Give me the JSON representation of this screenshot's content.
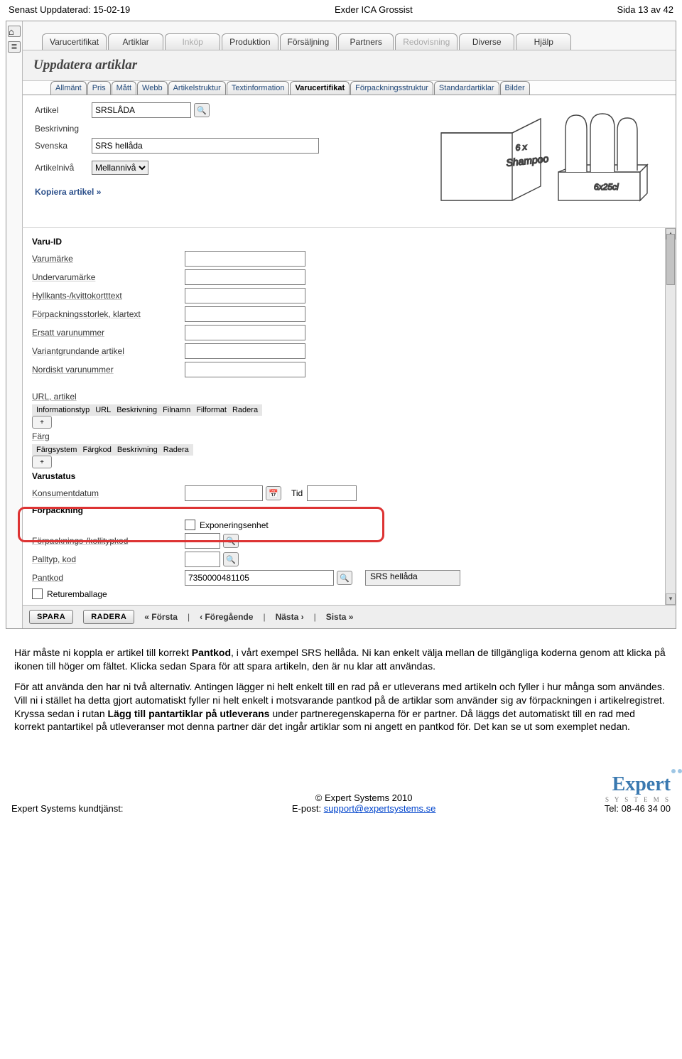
{
  "doc_header": {
    "left": "Senast Uppdaterad: 15-02-19",
    "center": "Exder ICA Grossist",
    "right": "Sida 13 av 42"
  },
  "toolbar_tabs": [
    "Varucertifikat",
    "Artiklar",
    "Inköp",
    "Produktion",
    "Försäljning",
    "Partners",
    "Redovisning",
    "Diverse",
    "Hjälp"
  ],
  "toolbar_disabled": [
    2,
    6
  ],
  "heading": "Uppdatera artiklar",
  "subtabs": [
    "Allmänt",
    "Pris",
    "Mått",
    "Webb",
    "Artikelstruktur",
    "Textinformation",
    "Varucertifikat",
    "Förpackningsstruktur",
    "Standardartiklar",
    "Bilder"
  ],
  "subtab_active": 6,
  "form": {
    "artikel_label": "Artikel",
    "artikel_value": "SRSLÅDA",
    "beskrivning_label": "Beskrivning",
    "svenska_label": "Svenska",
    "svenska_value": "SRS hellåda",
    "artikelniva_label": "Artikelnivå",
    "artikelniva_value": "Mellannivå",
    "kopiera": "Kopiera artikel »",
    "box_label": [
      "6 x",
      "Shampoo"
    ],
    "bottles_label": "6x25cl"
  },
  "details": {
    "section_varuid": "Varu-ID",
    "rows1": [
      "Varumärke",
      "Undervarumärke",
      "Hyllkants-/kvittokortttext",
      "Förpackningsstorlek, klartext",
      "Ersatt varunummer",
      "Variantgrundande artikel",
      "Nordiskt varunummer"
    ],
    "url_label": "URL, artikel",
    "info_headers": [
      "Informationstyp",
      "URL",
      "Beskrivning",
      "Filnamn",
      "Filformat",
      "Radera"
    ],
    "farg_label": "Färg",
    "farg_headers": [
      "Färgsystem",
      "Färgkod",
      "Beskrivning",
      "Radera"
    ],
    "varustatus": "Varustatus",
    "konsument_label": "Konsumentdatum",
    "tid_label": "Tid",
    "forpackning_section": "Förpackning",
    "exponering": "Exponeringsenhet",
    "forpack_kolli": "Förpacknings-/kollitypkod",
    "palltyp": "Palltyp, kod",
    "pantkod_label": "Pantkod",
    "pantkod_value": "7350000481105",
    "pantkod_desc": "SRS hellåda",
    "returemb": "Returemballage"
  },
  "footer_bar": {
    "save": "SPARA",
    "delete": "RADERA",
    "nav": [
      "« Första",
      " | ",
      "‹ Föregående",
      " | ",
      "Nästa ›",
      " | ",
      "Sista »"
    ]
  },
  "body": {
    "p1a": "Här måste ni koppla er artikel till korrekt ",
    "p1b": "Pantkod",
    "p1c": ", i vårt exempel SRS hellåda. Ni kan enkelt välja mellan de tillgängliga koderna genom att klicka på ikonen till höger om fältet. Klicka sedan Spara för att spara artikeln, den är nu klar att användas.",
    "p2a": "För att använda den har ni två alternativ. Antingen lägger ni helt enkelt till en rad på er utleverans med artikeln och fyller i hur många som användes. Vill ni i stället ha detta gjort automatiskt fyller ni helt enkelt i motsvarande pantkod på de artiklar som använder sig av förpackningen i artikelregistret. Kryssa sedan i rutan ",
    "p2b": "Lägg till pantartiklar på utleverans",
    "p2c": " under partneregenskaperna för er partner. Då läggs det automatiskt till en rad med korrekt pantartikel på utleveranser mot denna partner där det ingår artiklar som ni angett en pantkod för. Det kan se ut som exemplet nedan."
  },
  "page_footer": {
    "copyright": "© Expert Systems 2010",
    "left": "Expert Systems kundtjänst:",
    "email_label": "E-post: ",
    "email": "support@expertsystems.se",
    "tel": "Tel: 08-46 34 00",
    "logo_main": "Exper",
    "logo_sub": "S Y S T E M S"
  }
}
